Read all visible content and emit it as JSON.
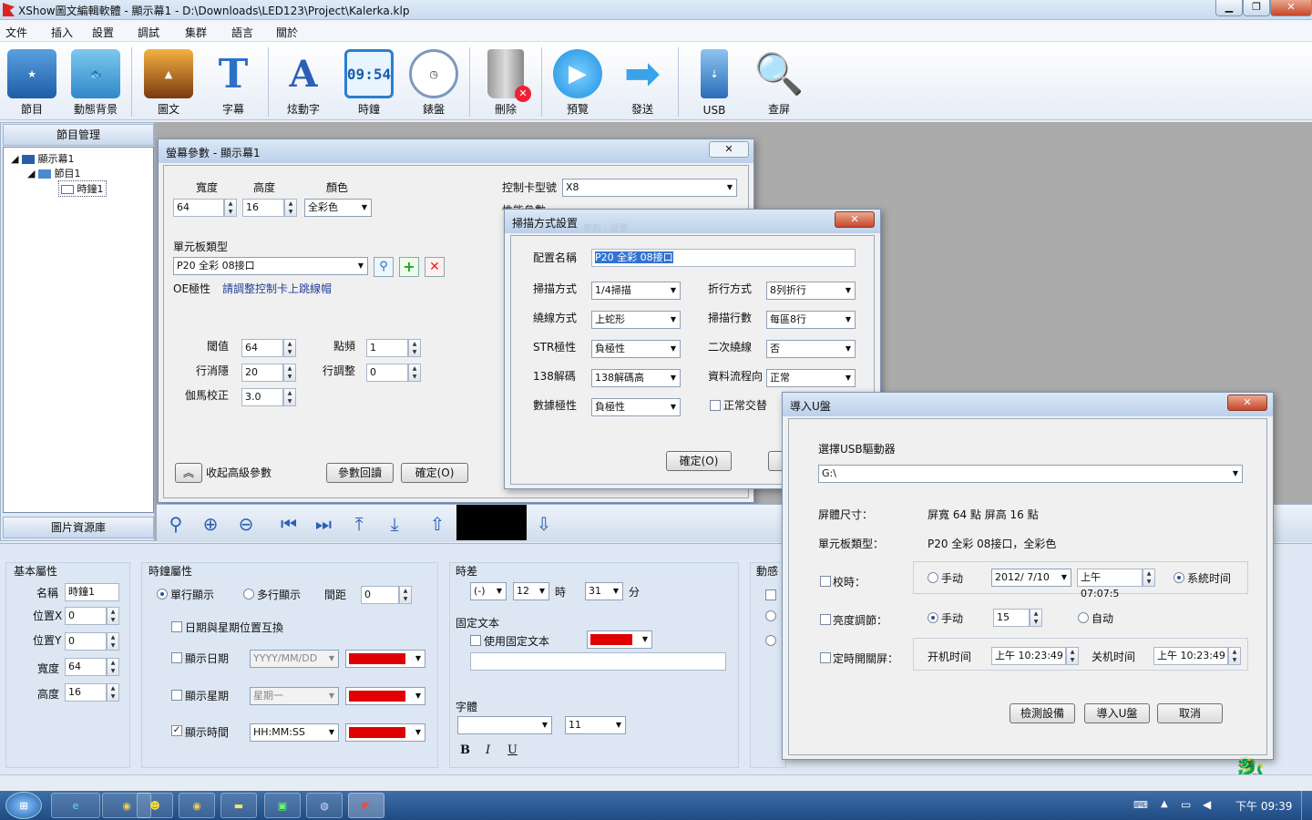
{
  "window_title": "XShow圖文編輯軟體 - 顯示幕1 - D:\\Downloads\\LED123\\Project\\Kalerka.klp",
  "menu": [
    "文件",
    "插入",
    "設置",
    "調試",
    "集群",
    "語言",
    "關於"
  ],
  "toolbar": [
    {
      "label": "節目",
      "icon": "clapper-icon",
      "color": "#2c6fb3"
    },
    {
      "label": "動態背景",
      "icon": "fish-icon",
      "color": "#e06a1f"
    },
    {
      "label": "圖文",
      "icon": "photo-icon",
      "color": "#c87a1e"
    },
    {
      "label": "字幕",
      "icon": "text-t-icon",
      "color": "#2b72c7"
    },
    {
      "label": "炫動字",
      "icon": "animated-a-icon",
      "color": "#c7a21a"
    },
    {
      "label": "時鐘",
      "icon": "digital-clock-icon",
      "color": "#1d6fb5"
    },
    {
      "label": "錶盤",
      "icon": "analog-clock-icon",
      "color": "#7d98c0"
    },
    {
      "label": "刪除",
      "icon": "trash-icon",
      "color": "#777777"
    },
    {
      "label": "預覽",
      "icon": "play-icon",
      "color": "#1d8fe0"
    },
    {
      "label": "發送",
      "icon": "send-arrow-icon",
      "color": "#3aa3e8"
    },
    {
      "label": "USB",
      "icon": "usb-icon",
      "color": "#2a6db8"
    },
    {
      "label": "查屏",
      "icon": "magnifier-icon",
      "color": "#c29a3a"
    }
  ],
  "digital_clock_text": "09:54",
  "left": {
    "program_mgmt": "節目管理",
    "tree": [
      "顯示幕1",
      "節目1",
      "時鐘1"
    ],
    "image_lib": "圖片資源庫"
  },
  "screen_params": {
    "title": "螢幕參數 - 顯示幕1",
    "width_label": "寬度",
    "width_val": "64",
    "height_label": "高度",
    "height_val": "16",
    "color_label": "顏色",
    "color_val": "全彩色",
    "card_label": "控制卡型號",
    "card_val": "X8",
    "perf_label": "性能參數",
    "unit_label": "單元板類型",
    "unit_val": "P20 全彩 08接口",
    "oe_label": "OE極性",
    "oe_hint": "請調整控制卡上跳線帽",
    "threshold_label": "閾值",
    "threshold_val": "64",
    "freq_label": "點頻",
    "freq_val": "1",
    "blank_label": "行消隱",
    "blank_val": "20",
    "rowadj_label": "行調整",
    "rowadj_val": "0",
    "gamma_label": "伽馬校正",
    "gamma_val": "3.0",
    "collapse": "收起高級參數",
    "readback": "參數回讀",
    "ok": "確定(O)"
  },
  "scan_dialog": {
    "title": "掃描方式設置",
    "ghost": "參數 · 設置",
    "config_label": "配置名稱",
    "config_val": "P20 全彩 08接口",
    "scan_label": "掃描方式",
    "scan_val": "1/4掃描",
    "fold_label": "折行方式",
    "fold_val": "8列折行",
    "route_label": "繞線方式",
    "route_val": "上蛇形",
    "rows_label": "掃描行數",
    "rows_val": "每區8行",
    "str_label": "STR極性",
    "str_val": "負極性",
    "sec_label": "二次繞線",
    "sec_val": "否",
    "dec_label": "138解碼",
    "dec_val": "138解碼高",
    "flow_label": "資料流程向",
    "flow_val": "正常",
    "data_label": "數據極性",
    "data_val": "負極性",
    "swap_label": "正常交替",
    "ok": "確定(O)"
  },
  "usb_dialog": {
    "title": "導入U盤",
    "select_label": "選擇USB驅動器",
    "drive": "G:\\",
    "size_label": "屏體尺寸：",
    "size_val": "屏寬 64 點 屏高 16 點",
    "unit_label": "單元板類型：",
    "unit_val": "P20 全彩 08接口，全彩色",
    "time_label": "校時：",
    "manual": "手动",
    "date": "2012/ 7/10",
    "time": "上午 07:07:5",
    "system_time": "系統时间",
    "bright_label": "亮度調節：",
    "manual2": "手动",
    "bright_val": "15",
    "auto": "自动",
    "timer_label": "定時開關屏：",
    "on_label": "开机时间",
    "on_time": "上午 10:23:49",
    "off_label": "关机时间",
    "off_time": "上午 10:23:49",
    "detect": "檢測設備",
    "import": "導入U盤",
    "cancel": "取消"
  },
  "props": {
    "basic_title": "基本屬性",
    "name_label": "名稱",
    "name_val": "時鐘1",
    "x_label": "位置X",
    "x_val": "0",
    "y_label": "位置Y",
    "y_val": "0",
    "w_label": "寬度",
    "w_val": "64",
    "h_label": "高度",
    "h_val": "16",
    "clock_title": "時鐘屬性",
    "single": "單行顯示",
    "multi": "多行顯示",
    "gap_label": "間距",
    "gap_val": "0",
    "swap": "日期與星期位置互換",
    "show_date": "顯示日期",
    "date_fmt": "YYYY/MM/DD",
    "show_week": "顯示星期",
    "week_fmt": "星期一",
    "show_time": "顯示時間",
    "time_fmt": "HH:MM:SS",
    "tz_title": "時差",
    "tz_sign": "(-)",
    "tz_hour": "12",
    "hour_unit": "時",
    "tz_min": "31",
    "min_unit": "分",
    "fixed_title": "固定文本",
    "use_fixed": "使用固定文本",
    "font_title": "字體",
    "font_size": "11",
    "bold": "B",
    "italic": "I",
    "underline": "U",
    "anim_title": "動感"
  },
  "taskbar": {
    "clock": "下午 09:39"
  },
  "colors": {
    "swatch": "#e00000",
    "accent": "#2c5ea8"
  }
}
